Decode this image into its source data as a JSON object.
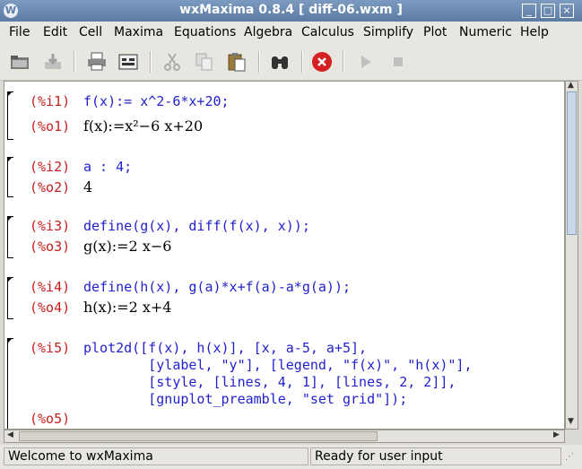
{
  "window": {
    "title": "wxMaxima 0.8.4  [ diff-06.wxm ]",
    "app_icon": "wx-logo-icon"
  },
  "menu": [
    "File",
    "Edit",
    "Cell",
    "Maxima",
    "Equations",
    "Algebra",
    "Calculus",
    "Simplify",
    "Plot",
    "Numeric",
    "Help"
  ],
  "cells": [
    {
      "in_label": "(%i1)",
      "input": [
        "f(x):= x^2-6*x+20;"
      ],
      "out_label": "(%o1)",
      "output": "f(x):=x²−6 x+20"
    },
    {
      "in_label": "(%i2)",
      "input": [
        "a : 4;"
      ],
      "out_label": "(%o2)",
      "output": "4"
    },
    {
      "in_label": "(%i3)",
      "input": [
        "define(g(x), diff(f(x), x));"
      ],
      "out_label": "(%o3)",
      "output": "g(x):=2 x−6"
    },
    {
      "in_label": "(%i4)",
      "input": [
        "define(h(x), g(a)*x+f(a)-a*g(a));"
      ],
      "out_label": "(%o4)",
      "output": "h(x):=2 x+4"
    },
    {
      "in_label": "(%i5)",
      "input": [
        "plot2d([f(x), h(x)], [x, a-5, a+5],",
        "        [ylabel, \"y\"], [legend, \"f(x)\", \"h(x)\"],",
        "        [style, [lines, 4, 1], [lines, 2, 2]],",
        "        [gnuplot_preamble, \"set grid\"]);"
      ],
      "out_label": "(%o5)",
      "output": ""
    }
  ],
  "status": {
    "left": "Welcome to wxMaxima",
    "right": "Ready for user input"
  }
}
